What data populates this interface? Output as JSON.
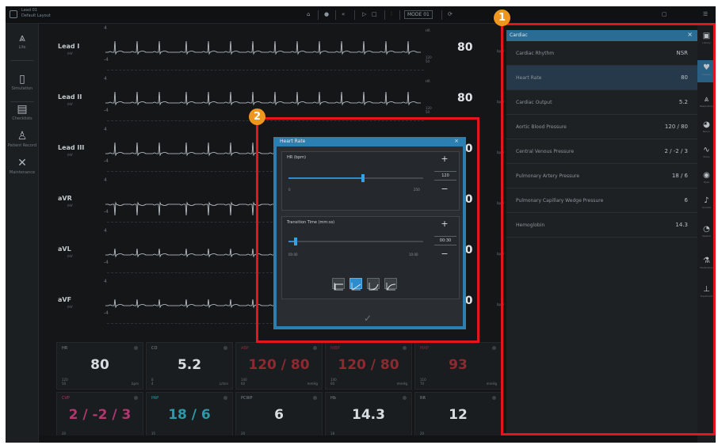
{
  "app": {
    "title_line1": "Lead 01",
    "title_line2": "Default Layout"
  },
  "toolbar": {
    "mode_box": "MODE 01"
  },
  "leftnav": [
    {
      "icon": "lungs-icon",
      "glyph": "⩓",
      "label": "Life"
    },
    {
      "icon": "device-icon",
      "glyph": "▯",
      "label": "Simulation"
    },
    {
      "icon": "document-icon",
      "glyph": "▤",
      "label": "Checklists"
    },
    {
      "icon": "patient-icon",
      "glyph": "♙",
      "label": "Patient Record"
    },
    {
      "icon": "tools-icon",
      "glyph": "✕",
      "label": "Maintenance"
    }
  ],
  "leads": [
    {
      "name": "Lead I",
      "unit": "mV",
      "scale_top": "4",
      "scale_bot": "-4",
      "hr": "80",
      "hr_top": "HR",
      "hr_bot": "120\n50",
      "bpm": "bpm"
    },
    {
      "name": "Lead II",
      "unit": "mV",
      "scale_top": "4",
      "scale_bot": "-4",
      "hr": "80",
      "hr_top": "HR",
      "hr_bot": "120\n50",
      "bpm": "bpm"
    },
    {
      "name": "Lead III",
      "unit": "mV",
      "scale_top": "4",
      "scale_bot": "-4",
      "hr": "80",
      "hr_top": "",
      "hr_bot": "",
      "bpm": "bpm"
    },
    {
      "name": "aVR",
      "unit": "mV",
      "scale_top": "4",
      "scale_bot": "-4",
      "hr": "80",
      "hr_top": "",
      "hr_bot": "",
      "bpm": "bpm"
    },
    {
      "name": "aVL",
      "unit": "mV",
      "scale_top": "4",
      "scale_bot": "-4",
      "hr": "80",
      "hr_top": "",
      "hr_bot": "",
      "bpm": "bpm"
    },
    {
      "name": "aVF",
      "unit": "mV",
      "scale_top": "4",
      "scale_bot": "-4",
      "hr": "80",
      "hr_top": "",
      "hr_bot": "",
      "bpm": "bpm"
    }
  ],
  "tiles": [
    {
      "label": "HR",
      "value": "80",
      "unit": "bpm",
      "lo": "120\n50",
      "color": "normal"
    },
    {
      "label": "CO",
      "value": "5.2",
      "unit": "L/min",
      "lo": "8\n4",
      "color": "normal"
    },
    {
      "label": "ABP",
      "value": "120 / 80",
      "unit": "mmHg",
      "lo": "140\n60",
      "color": "red"
    },
    {
      "label": "NIBP",
      "value": "120 / 80",
      "unit": "mmHg",
      "lo": "140\n60",
      "color": "red"
    },
    {
      "label": "MAP",
      "value": "93",
      "unit": "mmHg",
      "lo": "110\n70",
      "color": "red"
    },
    {
      "label": "CVP",
      "value": "2 / -2 / 3",
      "unit": "",
      "lo": "20",
      "color": "pink"
    },
    {
      "label": "PAP",
      "value": "18 / 6",
      "unit": "",
      "lo": "35",
      "color": "teal"
    },
    {
      "label": "PCWP",
      "value": "6",
      "unit": "",
      "lo": "20",
      "color": "normal"
    },
    {
      "label": "Hb",
      "value": "14.3",
      "unit": "",
      "lo": "18",
      "color": "normal"
    },
    {
      "label": "RR",
      "value": "12",
      "unit": "",
      "lo": "20",
      "color": "normal"
    }
  ],
  "dialog": {
    "title": "Heart Rate",
    "hr_group_title": "HR (bpm)",
    "hr_value": "120",
    "hr_fraction": 0.55,
    "hr_min": "0",
    "hr_max": "250",
    "transition_title": "Transition Time (mm:ss)",
    "transition_value": "00:30",
    "transition_fraction": 0.05,
    "tr_min": "00:00",
    "tr_max": "10:00",
    "plus": "+",
    "minus": "−",
    "close": "×",
    "confirm": "✓",
    "curves": [
      "curve-step-icon",
      "curve-linear-icon",
      "curve-ease-in-icon",
      "curve-ease-out-icon"
    ],
    "active_curve": 1
  },
  "right_panel": {
    "title": "Cardiac",
    "close": "×",
    "rows": [
      {
        "label": "Cardiac Rhythm",
        "value": "NSR"
      },
      {
        "label": "Heart Rate",
        "value": "80"
      },
      {
        "label": "Cardiac Output",
        "value": "5.2"
      },
      {
        "label": "Aortic Blood Pressure",
        "value": "120 / 80"
      },
      {
        "label": "Central Venous Pressure",
        "value": "2 / -2 / 3"
      },
      {
        "label": "Pulmonary Artery Pressure",
        "value": "18 / 6"
      },
      {
        "label": "Pulmonary Capillary Wedge Pressure",
        "value": "6"
      },
      {
        "label": "Hemoglobin",
        "value": "14.3"
      }
    ],
    "selected_index": 1
  },
  "right_rail": [
    {
      "icon": "library-icon",
      "glyph": "▣",
      "label": "Library"
    },
    {
      "icon": "heart-icon",
      "glyph": "♥",
      "label": "Cardiac"
    },
    {
      "icon": "lungs-icon",
      "glyph": "⩓",
      "label": "Respiratory"
    },
    {
      "icon": "brain-icon",
      "glyph": "◕",
      "label": "Neuro"
    },
    {
      "icon": "pulse-icon",
      "glyph": "∿",
      "label": "Pulse"
    },
    {
      "icon": "eye-icon",
      "glyph": "◉",
      "label": "Eyes"
    },
    {
      "icon": "sound-icon",
      "glyph": "♪",
      "label": "Sounds"
    },
    {
      "icon": "speech-icon",
      "glyph": "◔",
      "label": "Speech"
    },
    {
      "icon": "medication-icon",
      "glyph": "⚗",
      "label": "Medication"
    },
    {
      "icon": "treatment-icon",
      "glyph": "⊥",
      "label": "Treatment"
    }
  ],
  "annotations": {
    "badge1": "1",
    "badge2": "2"
  },
  "colors": {
    "accent": "#2d8ccc",
    "annotation_red": "#e3161d",
    "badge_orange": "#f0961e"
  }
}
